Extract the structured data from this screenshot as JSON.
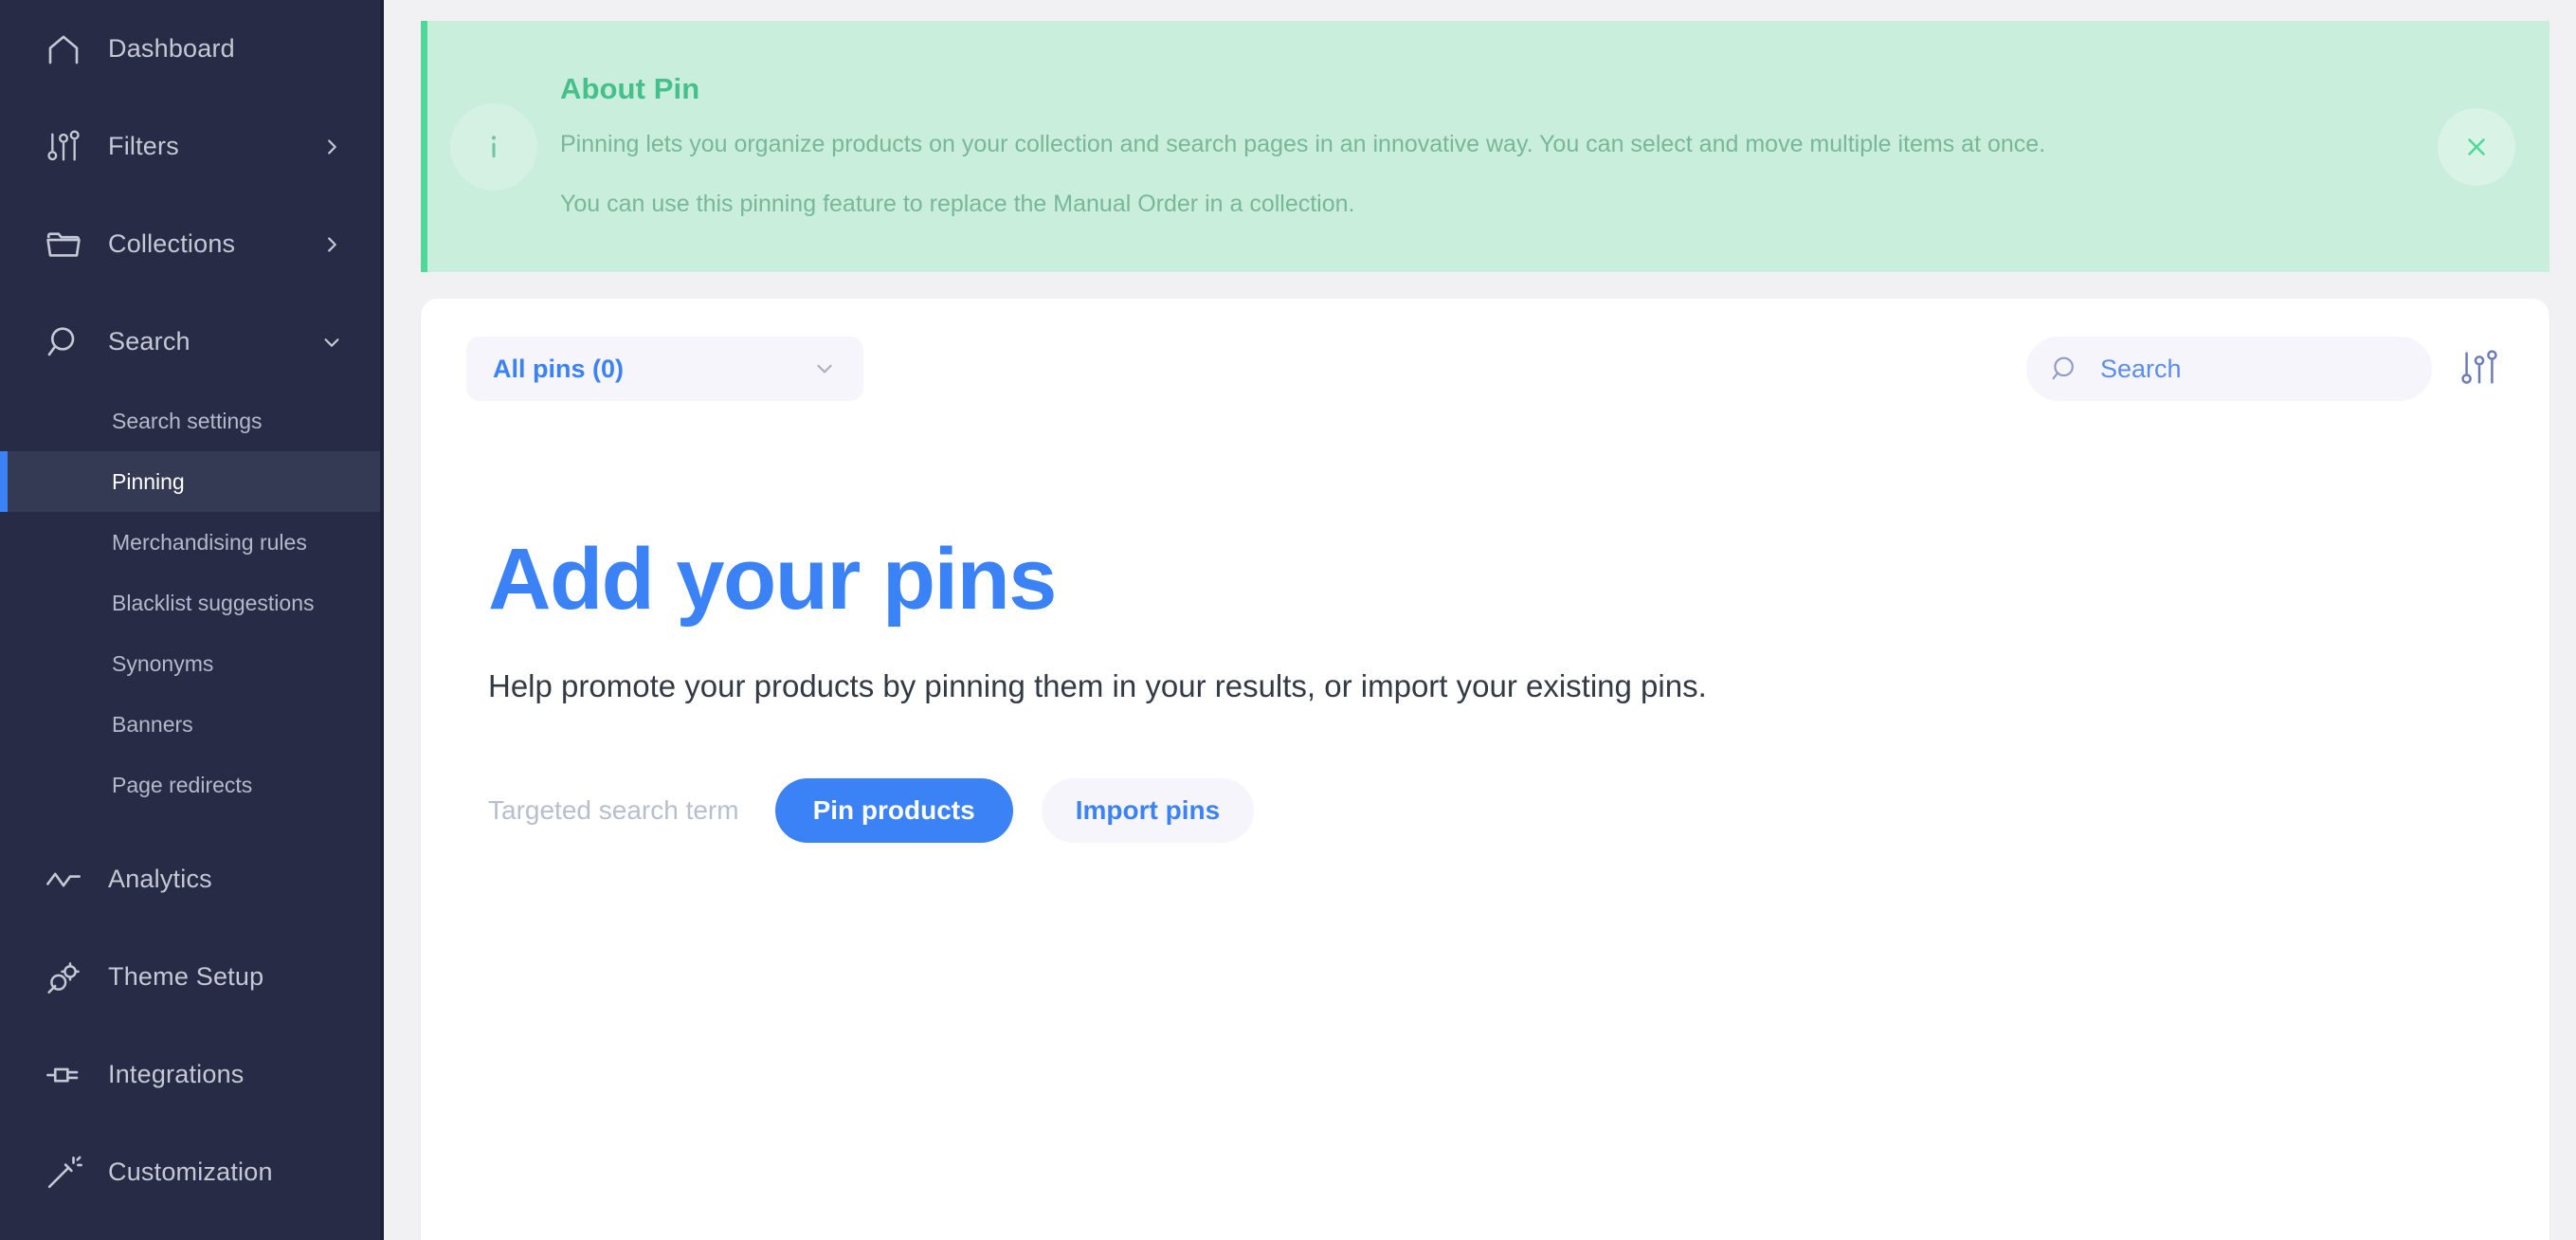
{
  "sidebar": {
    "items": [
      {
        "label": "Dashboard",
        "icon": "home-icon",
        "expand": "none"
      },
      {
        "label": "Filters",
        "icon": "sliders-icon",
        "expand": "right"
      },
      {
        "label": "Collections",
        "icon": "folder-icon",
        "expand": "right"
      },
      {
        "label": "Search",
        "icon": "search-icon",
        "expand": "down"
      }
    ],
    "search_subitems": [
      {
        "label": "Search settings",
        "active": false
      },
      {
        "label": "Pinning",
        "active": true
      },
      {
        "label": "Merchandising rules",
        "active": false
      },
      {
        "label": "Blacklist suggestions",
        "active": false
      },
      {
        "label": "Synonyms",
        "active": false
      },
      {
        "label": "Banners",
        "active": false
      },
      {
        "label": "Page redirects",
        "active": false
      }
    ],
    "items_bottom": [
      {
        "label": "Analytics",
        "icon": "chart-line-icon"
      },
      {
        "label": "Theme Setup",
        "icon": "theme-gears-icon"
      },
      {
        "label": "Integrations",
        "icon": "plug-icon"
      },
      {
        "label": "Customization",
        "icon": "magic-wand-icon"
      }
    ],
    "active_color": "#3b82f6",
    "background": "#272B45"
  },
  "banner": {
    "icon": "info-icon",
    "title": "About Pin",
    "line1": "Pinning lets you organize products on your collection and search pages in an innovative way. You can select and move multiple items at once.",
    "line2": "You can use this pinning feature to replace the Manual Order in a collection.",
    "close_icon": "close-icon",
    "accent_color": "#4ed99b",
    "background": "#c9eedb"
  },
  "toolbar": {
    "pins_filter_label": "All pins (0)",
    "pins_filter_icon": "chevron-down-icon",
    "search_icon": "search-icon",
    "search_value": "",
    "search_placeholder": "Search",
    "filter_icon": "sliders-icon"
  },
  "empty_state": {
    "title": "Add your pins",
    "description": "Help promote your products by pinning them in your results, or import your existing pins.",
    "targeted_term_label": "Targeted search term",
    "primary_button": "Pin products",
    "secondary_button": "Import pins",
    "primary_color": "#3b82f6"
  }
}
